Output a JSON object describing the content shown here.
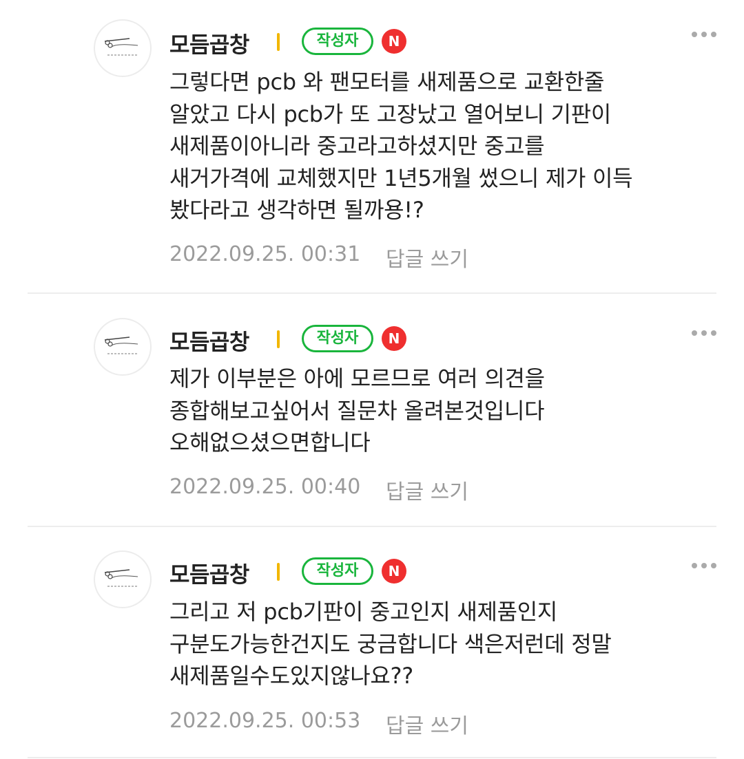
{
  "comments": [
    {
      "author": "모듬곱창",
      "author_badge": "작성자",
      "new_badge": "N",
      "lines": [
        "그렇다면 pcb 와 팬모터를 새제품으로 교환한줄",
        "알았고 다시 pcb가 또 고장났고 열어보니 기판이",
        "새제품이아니라 중고라고하셨지만 중고를",
        "새거가격에 교체했지만 1년5개월 썼으니 제가 이득",
        "봤다라고 생각하면 될까용!?"
      ],
      "date": "2022.09.25. 00:31",
      "reply_label": "답글 쓰기"
    },
    {
      "author": "모듬곱창",
      "author_badge": "작성자",
      "new_badge": "N",
      "lines": [
        "제가 이부분은 아에 모르므로 여러 의견을",
        "종합해보고싶어서 질문차 올려본것입니다",
        "오해없으셨으면합니다"
      ],
      "date": "2022.09.25. 00:40",
      "reply_label": "답글 쓰기"
    },
    {
      "author": "모듬곱창",
      "author_badge": "작성자",
      "new_badge": "N",
      "lines": [
        "그리고 저 pcb기판이 중고인지 새제품인지",
        "구분도가능한건지도 궁금합니다 색은저런데 정말",
        "새제품일수도있지않나요??"
      ],
      "date": "2022.09.25. 00:53",
      "reply_label": "답글 쓰기"
    }
  ],
  "icons": {
    "avatar": "hair-salon-logo-avatar",
    "author_mark": "author-level-mark-icon",
    "new": "new-badge-icon",
    "more": "more-options-icon"
  },
  "colors": {
    "author_badge": "#19b53c",
    "new_badge": "#ef2f2f",
    "author_mark": "#f2b600",
    "meta_text": "#9b9b9b",
    "body_text": "#222222",
    "divider": "#ededed"
  }
}
